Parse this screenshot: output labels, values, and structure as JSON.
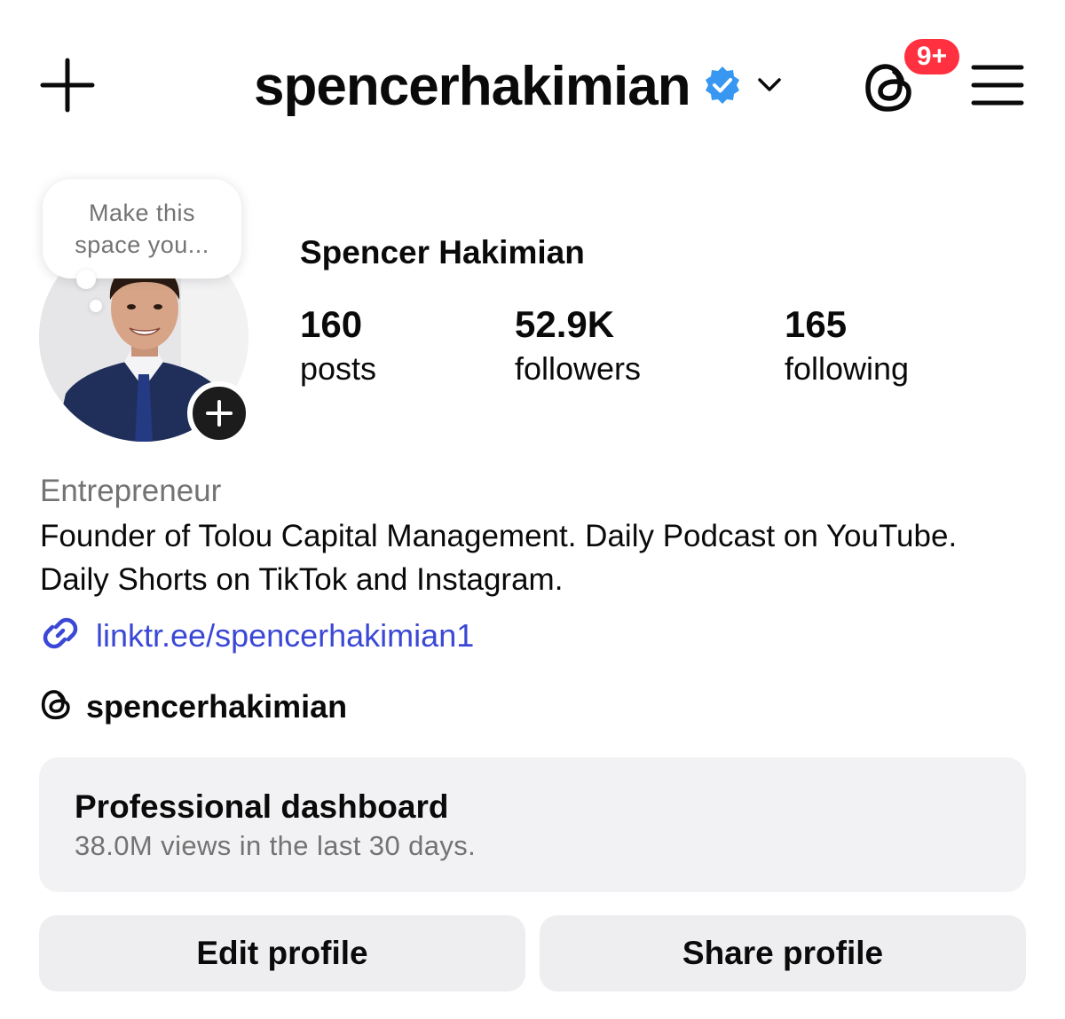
{
  "header": {
    "username": "spencerhakimian",
    "notification_badge": "9+",
    "verified_color": "#3897f0",
    "badge_color": "#ff3040"
  },
  "icons": {
    "new_post": "plus-icon",
    "verified": "verified-badge-icon",
    "account_switch": "chevron-down-icon",
    "threads": "threads-icon",
    "menu": "hamburger-menu-icon",
    "add_story": "plus-circle-icon",
    "link": "link-icon"
  },
  "profile": {
    "note_text": "Make this space you...",
    "full_name": "Spencer Hakimian",
    "stats": [
      {
        "value": "160",
        "label": "posts"
      },
      {
        "value": "52.9K",
        "label": "followers"
      },
      {
        "value": "165",
        "label": "following"
      }
    ],
    "category": "Entrepreneur",
    "bio": "Founder of Tolou Capital Management. Daily Podcast on YouTube. Daily Shorts on TikTok and Instagram.",
    "link": "linktr.ee/spencerhakimian1",
    "link_color": "#3b48d6",
    "threads_handle": "spencerhakimian"
  },
  "dashboard": {
    "title": "Professional dashboard",
    "subtitle": "38.0M views in the last 30 days."
  },
  "actions": {
    "edit": "Edit profile",
    "share": "Share profile"
  }
}
